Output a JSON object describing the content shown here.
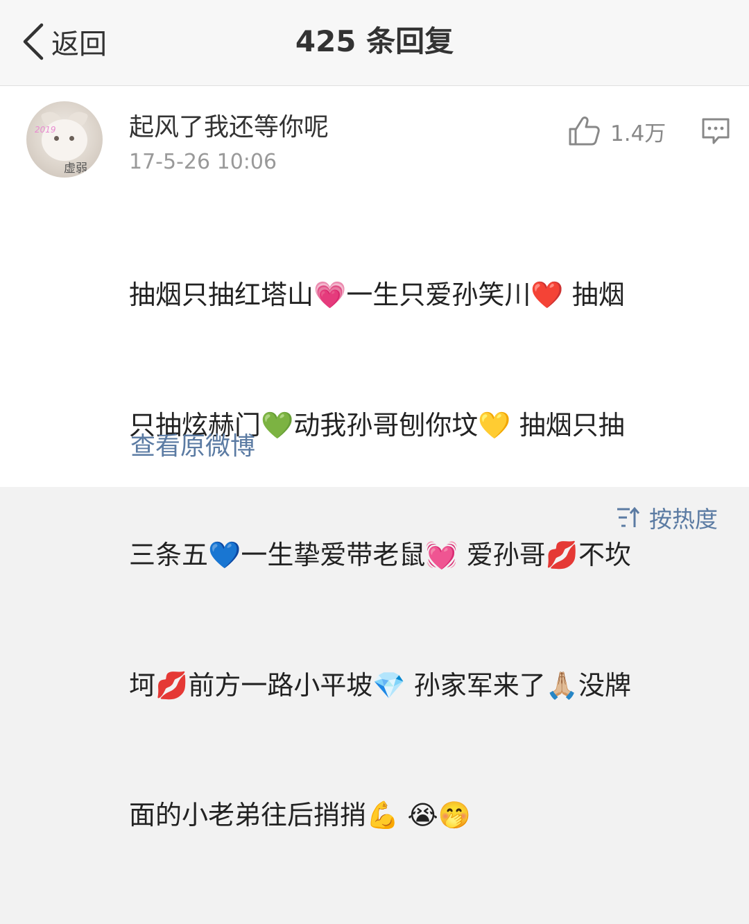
{
  "nav": {
    "back_label": "返回",
    "title": "425 条回复"
  },
  "comment": {
    "avatar_watermark": "2019",
    "avatar_caption": "虚弱",
    "username": "起风了我还等你呢",
    "timestamp": "17-5-26 10:06",
    "like_count": "1.4万",
    "text_lines": [
      "抽烟只抽红塔山💗一生只爱孙笑川❤️ 抽烟",
      "只抽炫赫门💚动我孙哥刨你坟💛 抽烟只抽",
      "三条五💙一生挚爱带老鼠💓 爱孙哥💋不坎",
      "坷💋前方一路小平坡💎 孙家军来了🙏🏼没牌",
      "面的小老弟往后捎捎💪 😭🤭"
    ],
    "view_original_label": "查看原微博"
  },
  "footer": {
    "sort_label": "按热度"
  },
  "colors": {
    "link": "#5b7ba3",
    "muted": "#999999",
    "nav_bg": "#f7f7f7",
    "page_bg": "#f2f2f2"
  },
  "icons": {
    "back": "chevron-left-icon",
    "like": "thumbs-up-icon",
    "comment": "comment-icon",
    "sort": "sort-icon"
  }
}
